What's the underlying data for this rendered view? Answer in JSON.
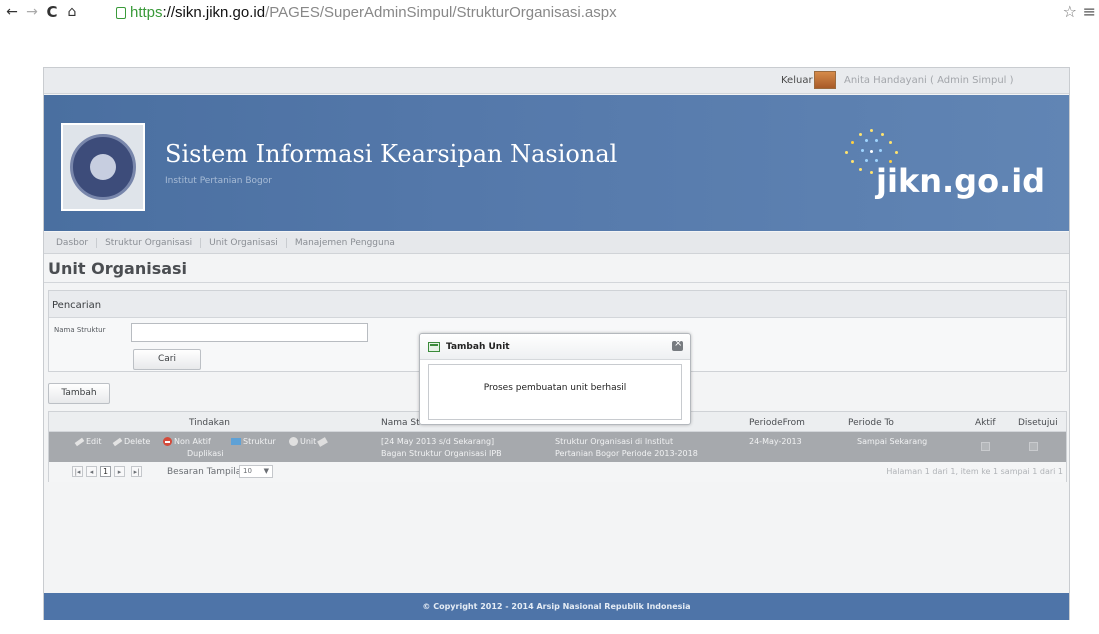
{
  "browser": {
    "url_https": "https",
    "url_host": "://sikn.jikn.go.id",
    "url_path": "/PAGES/SuperAdminSimpul/StrukturOrganisasi.aspx"
  },
  "header": {
    "logout": "Keluar",
    "user": "Anita Handayani ( Admin Simpul )",
    "site_title": "Sistem Informasi Kearsipan Nasional",
    "site_subtitle": "Institut Pertanian Bogor",
    "brand": "jikn.go.id"
  },
  "tabs": [
    {
      "label": "Dasbor"
    },
    {
      "label": "Struktur Organisasi"
    },
    {
      "label": "Unit Organisasi"
    },
    {
      "label": "Manajemen Pengguna"
    }
  ],
  "page_title": "Unit Organisasi",
  "search": {
    "heading": "Pencarian",
    "label": "Nama Struktur",
    "value": "",
    "button": "Cari"
  },
  "add_button": "Tambah",
  "grid": {
    "columns": {
      "actions": "Tindakan",
      "name": "Nama St",
      "period_from": "PeriodeFrom",
      "period_to": "Periode To",
      "active": "Aktif",
      "approved": "Disetujui"
    },
    "row": {
      "edit": "Edit",
      "delete": "Delete",
      "non_active": "Non Aktif",
      "structure": "Struktur",
      "unit": "Unit",
      "duplicate": "Duplikasi",
      "name_line1": "[24 May 2013 s/d Sekarang]",
      "name_line2": "Bagan Struktur Organisasi IPB",
      "desc_line1": "Struktur Organisasi di Institut",
      "desc_line2": "Pertanian Bogor Periode 2013-2018",
      "period_from": "24-May-2013",
      "period_to": "Sampai Sekarang"
    },
    "pager": {
      "current_page": "1",
      "page_size_label": "Besaran Tampilan",
      "page_size": "10",
      "info": "Halaman 1 dari 1, item ke 1 sampai 1 dari 1"
    }
  },
  "footer": "© Copyright 2012 - 2014 Arsip Nasional Republik Indonesia",
  "modal": {
    "title": "Tambah Unit",
    "message": "Proses pembuatan unit berhasil"
  },
  "colors": {
    "banner": "#5478aa",
    "footer": "#4e74a8",
    "row_selected": "#a6a9ad",
    "secure_url": "#3a9a3a"
  }
}
